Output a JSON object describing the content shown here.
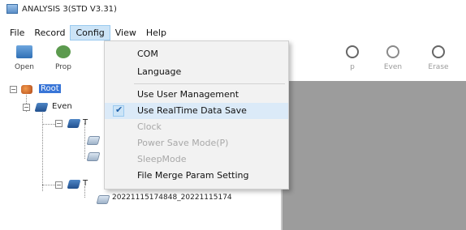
{
  "window": {
    "title": "ANALYSIS 3(STD V3.31)"
  },
  "menubar": {
    "items": [
      "File",
      "Record",
      "Config",
      "View",
      "Help"
    ]
  },
  "toolbar": {
    "buttons": [
      {
        "label": "Open",
        "icon": "open-folder-icon",
        "enabled": true
      },
      {
        "label": "Prop",
        "icon": "properties-icon",
        "enabled": true
      },
      {
        "label": "p",
        "icon": "stop-icon",
        "enabled": false
      },
      {
        "label": "Even",
        "icon": "event-icon",
        "enabled": false
      },
      {
        "label": "Erase",
        "icon": "erase-icon",
        "enabled": false
      }
    ]
  },
  "config_menu": {
    "items": [
      {
        "label": "COM",
        "checked": false,
        "enabled": true
      },
      {
        "label": "Language",
        "checked": false,
        "enabled": true
      },
      {
        "label": "Use User Management",
        "checked": false,
        "enabled": true
      },
      {
        "label": "Use RealTime Data Save",
        "checked": true,
        "enabled": true
      },
      {
        "label": "Clock",
        "checked": false,
        "enabled": false
      },
      {
        "label": "Power Save Mode(P)",
        "checked": false,
        "enabled": false
      },
      {
        "label": "SleepMode",
        "checked": false,
        "enabled": false
      },
      {
        "label": "File Merge Param Setting",
        "checked": false,
        "enabled": true
      }
    ]
  },
  "tree": {
    "root_label": "Root",
    "child_label": "Even",
    "sub_prefix": "T",
    "file_label": "20221115174848_20221115174"
  },
  "colors": {
    "menu_highlight": "#dbeaf8",
    "selection": "#3875d7",
    "right_pane": "#9c9c9c"
  }
}
